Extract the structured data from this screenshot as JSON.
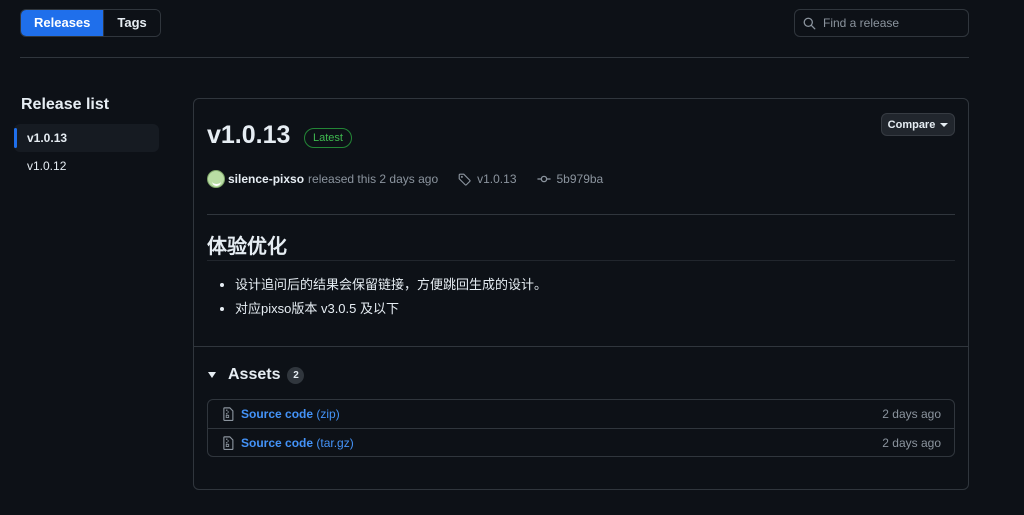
{
  "nav": {
    "tabs": [
      {
        "label": "Releases",
        "active": true
      },
      {
        "label": "Tags",
        "active": false
      }
    ],
    "search_placeholder": "Find a release"
  },
  "sidebar": {
    "title": "Release list",
    "items": [
      {
        "label": "v1.0.13",
        "active": true
      },
      {
        "label": "v1.0.12",
        "active": false
      }
    ]
  },
  "release": {
    "title": "v1.0.13",
    "badge": "Latest",
    "compare_label": "Compare",
    "author": "silence-pixso",
    "released_text": "released this 2 days ago",
    "tag": "v1.0.13",
    "commit": "5b979ba",
    "heading": "体验优化",
    "notes": [
      "设计追问后的结果会保留链接，方便跳回生成的设计。",
      "对应pixso版本 v3.0.5 及以下"
    ]
  },
  "assets": {
    "title": "Assets",
    "count": "2",
    "items": [
      {
        "name": "Source code",
        "ext": "(zip)",
        "date": "2 days ago"
      },
      {
        "name": "Source code",
        "ext": "(tar.gz)",
        "date": "2 days ago"
      }
    ]
  },
  "colors": {
    "accent": "#1f6feb",
    "link": "#4493f8",
    "latest_green": "#3fb950",
    "background": "#0d1117",
    "border": "#30363d"
  }
}
